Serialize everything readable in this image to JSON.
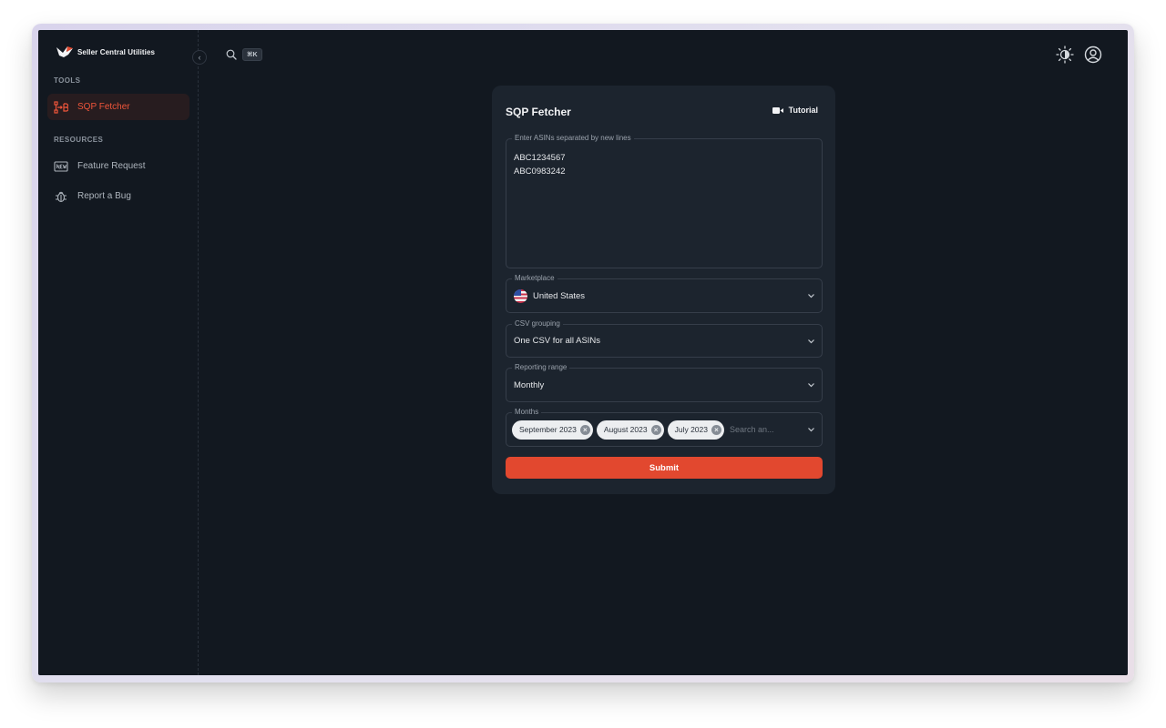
{
  "app": {
    "name": "Seller Central Utilities"
  },
  "sidebar": {
    "sections": [
      {
        "label": "TOOLS",
        "items": [
          {
            "label": "SQP Fetcher",
            "icon": "flow-icon",
            "active": true
          }
        ]
      },
      {
        "label": "RESOURCES",
        "items": [
          {
            "label": "Feature Request",
            "icon": "new-badge-icon"
          },
          {
            "label": "Report a Bug",
            "icon": "bug-icon"
          }
        ]
      }
    ]
  },
  "topbar": {
    "search_shortcut": "⌘K"
  },
  "form": {
    "title": "SQP Fetcher",
    "tutorial_label": "Tutorial",
    "asins": {
      "label": "Enter ASINs separated by new lines",
      "lines": [
        "ABC1234567",
        "ABC0983242"
      ]
    },
    "marketplace": {
      "label": "Marketplace",
      "value": "United States"
    },
    "csv_grouping": {
      "label": "CSV grouping",
      "value": "One CSV for all ASINs"
    },
    "reporting_range": {
      "label": "Reporting range",
      "value": "Monthly"
    },
    "months": {
      "label": "Months",
      "selected": [
        "September 2023",
        "August 2023",
        "July 2023"
      ],
      "placeholder": "Search an..."
    },
    "submit_label": "Submit"
  },
  "colors": {
    "accent": "#e2482f",
    "background": "#121820",
    "card": "#1c242e"
  }
}
